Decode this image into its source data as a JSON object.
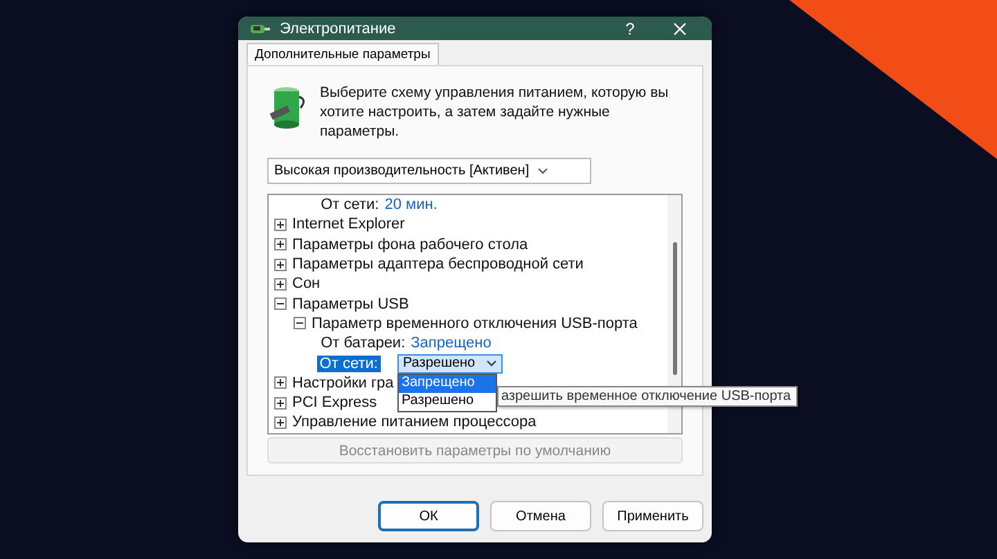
{
  "window": {
    "title": "Электропитание",
    "help": "?"
  },
  "tabs": [
    {
      "label": "Дополнительные параметры",
      "selected": true
    }
  ],
  "intro": "Выберите схему управления питанием, которую вы хотите настроить, а затем задайте нужные параметры.",
  "scheme": {
    "value": "Высокая производительность [Активен]"
  },
  "tree": [
    {
      "kind": "setting",
      "label": "От сети:",
      "value": "20 мин."
    },
    {
      "kind": "group",
      "label": "Internet Explorer",
      "expanded": false
    },
    {
      "kind": "group",
      "label": "Параметры фона рабочего стола",
      "expanded": false
    },
    {
      "kind": "group",
      "label": "Параметры адаптера беспроводной сети",
      "expanded": false
    },
    {
      "kind": "group",
      "label": "Сон",
      "expanded": false
    },
    {
      "kind": "group",
      "label": "Параметры USB",
      "expanded": true,
      "children": [
        {
          "kind": "group",
          "label": "Параметр временного отключения USB-порта",
          "expanded": true,
          "children": [
            {
              "kind": "setting",
              "label": "От батареи:",
              "value": "Запрещено"
            },
            {
              "kind": "select",
              "label": "От сети:",
              "value": "Разрешено",
              "selected": true,
              "open": true,
              "options": [
                {
                  "label": "Запрещено",
                  "highlighted": true
                },
                {
                  "label": "Разрешено",
                  "highlighted": false
                }
              ]
            }
          ]
        }
      ]
    },
    {
      "kind": "group",
      "label": "Настройки гра",
      "expanded": false
    },
    {
      "kind": "group",
      "label": "PCI Express",
      "expanded": false
    },
    {
      "kind": "group",
      "label": "Управление питанием процессора",
      "expanded": false
    }
  ],
  "tooltip": "азрешить временное отключение USB-порта",
  "restore_button": {
    "label": "Восстановить параметры по умолчанию",
    "disabled": true
  },
  "buttons": [
    {
      "label": "ОК",
      "default": true
    },
    {
      "label": "Отмена",
      "default": false
    },
    {
      "label": "Применить",
      "default": false
    }
  ]
}
